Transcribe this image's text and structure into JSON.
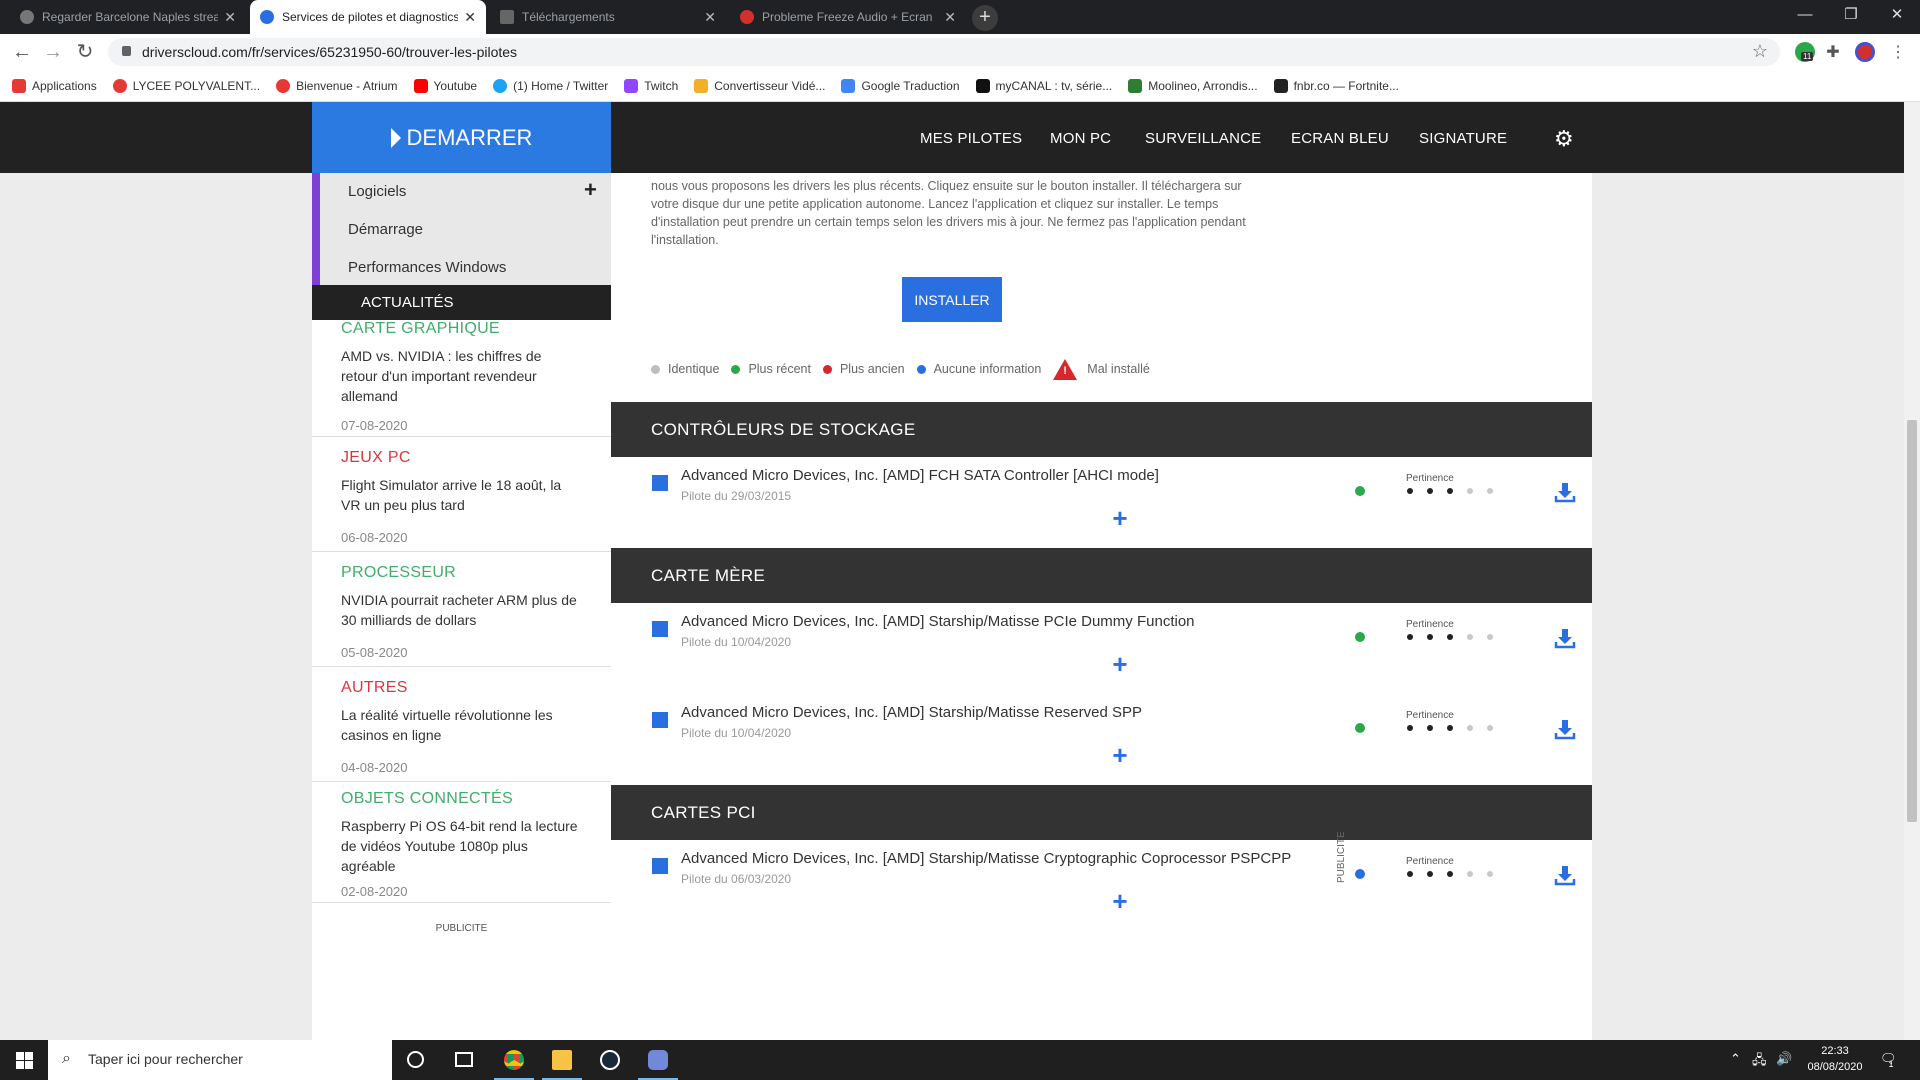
{
  "browser": {
    "tabs": [
      {
        "title": "Regarder Barcelone Naples strea",
        "active": false
      },
      {
        "title": "Services de pilotes et diagnostics",
        "active": true
      },
      {
        "title": "Téléchargements",
        "active": false
      },
      {
        "title": "Probleme Freeze Audio + Ecran",
        "active": false
      }
    ],
    "url": "driverscloud.com/fr/services/65231950-60/trouver-les-pilotes",
    "bookmarks": [
      "Applications",
      "LYCEE POLYVALENT...",
      "Bienvenue - Atrium",
      "Youtube",
      "(1) Home / Twitter",
      "Twitch",
      "Convertisseur Vidé...",
      "Google Traduction",
      "myCANAL : tv, série...",
      "Moolineo, Arrondis...",
      "fnbr.co — Fortnite..."
    ],
    "extension_badge": "11"
  },
  "site": {
    "start_label": "DEMARRER",
    "menu": [
      "MES PILOTES",
      "MON PC",
      "SURVEILLANCE",
      "ECRAN BLEU",
      "SIGNATURE"
    ]
  },
  "sidebar": {
    "items": [
      "Logiciels",
      "Démarrage",
      "Performances Windows"
    ],
    "news_header": "ACTUALITÉS",
    "news": [
      {
        "category": "CARTE GRAPHIQUE",
        "color": "#3fae6a",
        "text": "AMD vs. NVIDIA : les chiffres de retour d'un important revendeur allemand",
        "date": "07-08-2020"
      },
      {
        "category": "JEUX PC",
        "color": "#d9363e",
        "text": "Flight Simulator arrive le 18 août, la VR un peu plus tard",
        "date": "06-08-2020"
      },
      {
        "category": "PROCESSEUR",
        "color": "#3fae6a",
        "text": "NVIDIA pourrait racheter ARM plus de 30 milliards de dollars",
        "date": "05-08-2020"
      },
      {
        "category": "AUTRES",
        "color": "#d9363e",
        "text": "La réalité virtuelle révolutionne les casinos en ligne",
        "date": "04-08-2020"
      },
      {
        "category": "OBJETS CONNECTÉS",
        "color": "#3fae6a",
        "text": "Raspberry Pi OS 64-bit rend la lecture de vidéos Youtube 1080p plus agréable",
        "date": "02-08-2020"
      }
    ],
    "pub_label": "PUBLICITE"
  },
  "main": {
    "intro": "nous vous proposons les drivers les plus récents. Cliquez ensuite sur le bouton installer. Il téléchargera sur votre disque dur une petite application autonome. Lancez l'application et cliquez sur installer. Le temps d'installation peut prendre un certain temps selon les drivers mis à jour. Ne fermez pas l'application pendant l'installation.",
    "install_label": "INSTALLER",
    "legend": [
      {
        "label": "Identique",
        "color": "#bdbdbd"
      },
      {
        "label": "Plus récent",
        "color": "#2ba84a"
      },
      {
        "label": "Plus ancien",
        "color": "#d7262c"
      },
      {
        "label": "Aucune information",
        "color": "#2a6fe0"
      }
    ],
    "legend_warning": "Mal installé",
    "pertinence_label": "Pertinence",
    "sections": [
      {
        "title": "CONTRÔLEURS DE STOCKAGE",
        "drivers": [
          {
            "name": "Advanced Micro Devices, Inc. [AMD] FCH SATA Controller [AHCI mode]",
            "date": "Pilote du 29/03/2015",
            "status_color": "#2ba84a",
            "pertinence": 3
          }
        ]
      },
      {
        "title": "CARTE MÈRE",
        "drivers": [
          {
            "name": "Advanced Micro Devices, Inc. [AMD] Starship/Matisse PCIe Dummy Function",
            "date": "Pilote du 10/04/2020",
            "status_color": "#2ba84a",
            "pertinence": 3
          },
          {
            "name": "Advanced Micro Devices, Inc. [AMD] Starship/Matisse Reserved SPP",
            "date": "Pilote du 10/04/2020",
            "status_color": "#2ba84a",
            "pertinence": 3
          }
        ]
      },
      {
        "title": "CARTES PCI",
        "drivers": [
          {
            "name": "Advanced Micro Devices, Inc. [AMD] Starship/Matisse Cryptographic Coprocessor PSPCPP",
            "date": "Pilote du 06/03/2020",
            "status_color": "#2a6fe0",
            "pertinence": 3
          }
        ]
      }
    ],
    "pub_vertical": "PUBLICITE"
  },
  "taskbar": {
    "search_placeholder": "Taper ici pour rechercher",
    "time": "22:33",
    "date": "08/08/2020",
    "notification_count": "1"
  }
}
